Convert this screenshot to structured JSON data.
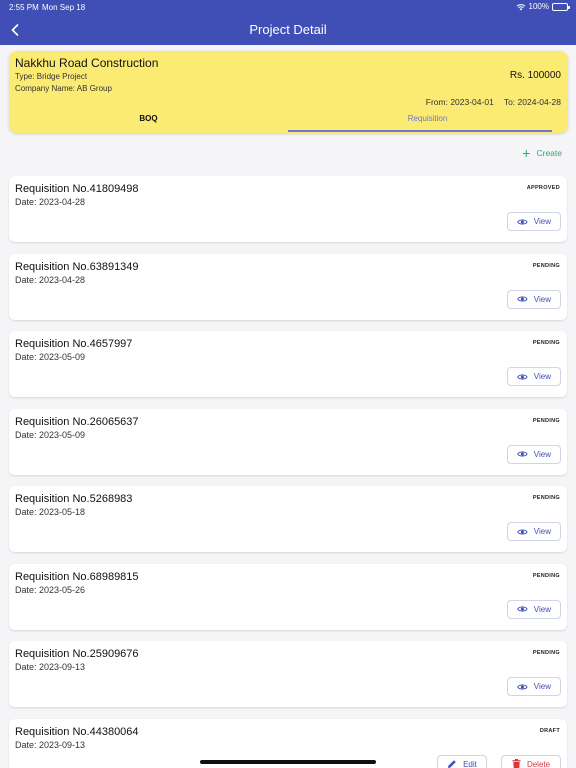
{
  "status_bar": {
    "time": "2:55 PM",
    "date": "Mon Sep 18",
    "battery": "100%"
  },
  "header": {
    "title": "Project Detail"
  },
  "project": {
    "name": "Nakkhu Road Construction",
    "type": "Type: Bridge Project",
    "company": "Company Name: AB Group",
    "amount": "Rs. 100000",
    "from": "From: 2023-04-01",
    "to": "To: 2024-04-28"
  },
  "tabs": [
    {
      "label": "BOQ"
    },
    {
      "label": "Requisition"
    }
  ],
  "create_label": "Create",
  "requisitions": [
    {
      "number": "Requisition No.41809498",
      "date": "Date: 2023-04-28",
      "status": "APPROVED",
      "action": "View"
    },
    {
      "number": "Requisition No.63891349",
      "date": "Date: 2023-04-28",
      "status": "PENDING",
      "action": "View"
    },
    {
      "number": "Requisition No.4657997",
      "date": "Date: 2023-05-09",
      "status": "PENDING",
      "action": "View"
    },
    {
      "number": "Requisition No.26065637",
      "date": "Date: 2023-05-09",
      "status": "PENDING",
      "action": "View"
    },
    {
      "number": "Requisition No.5268983",
      "date": "Date: 2023-05-18",
      "status": "PENDING",
      "action": "View"
    },
    {
      "number": "Requisition No.68989815",
      "date": "Date: 2023-05-26",
      "status": "PENDING",
      "action": "View"
    },
    {
      "number": "Requisition No.25909676",
      "date": "Date: 2023-09-13",
      "status": "PENDING",
      "action": "View"
    },
    {
      "number": "Requisition No.44380064",
      "date": "Date: 2023-09-13",
      "status": "DRAFT",
      "edit": "Edit",
      "delete": "Delete"
    }
  ]
}
